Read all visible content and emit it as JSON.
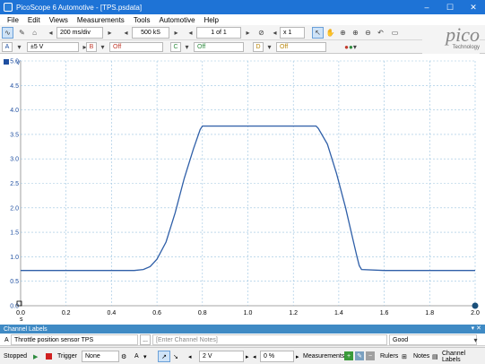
{
  "window": {
    "title": "PicoScope 6 Automotive - [TPS.psdata]",
    "minimize": "–",
    "maximize": "☐",
    "close": "✕"
  },
  "menu": [
    "File",
    "Edit",
    "Views",
    "Measurements",
    "Tools",
    "Automotive",
    "Help"
  ],
  "toolbar": {
    "timebase": "200 ms/div",
    "samples": "500 kS",
    "page_indicator": "1 of 1",
    "zoom": "x 1"
  },
  "channels": {
    "a_label": "A",
    "a_range": "±5 V",
    "b_label": "B",
    "b_value": "Off",
    "c_label": "C",
    "c_value": "Off",
    "d_label": "D",
    "d_value": "Off"
  },
  "logo": {
    "word": "pico",
    "sub": "Technology"
  },
  "axes": {
    "y_unit": "V",
    "y_ticks": [
      "5.0",
      "4.5",
      "4.0",
      "3.5",
      "3.0",
      "2.5",
      "2.0",
      "1.5",
      "1.0",
      "0.5",
      "0.0"
    ],
    "x_ticks": [
      "0.0",
      "0.2",
      "0.4",
      "0.6",
      "0.8",
      "1.0",
      "1.2",
      "1.4",
      "1.6",
      "1.8",
      "2.0"
    ],
    "x_unit": "s"
  },
  "chart_data": {
    "type": "line",
    "xlim": [
      0,
      2.0
    ],
    "ylim": [
      0,
      5.0
    ],
    "grid": true,
    "series": [
      {
        "color": "#2f5fa8",
        "x": [
          0.0,
          0.5,
          0.54,
          0.57,
          0.6,
          0.64,
          0.68,
          0.72,
          0.76,
          0.79,
          0.8,
          1.2,
          1.3,
          1.31,
          1.35,
          1.39,
          1.43,
          1.46,
          1.48,
          1.49,
          1.5,
          1.6,
          2.0
        ],
        "y": [
          0.72,
          0.72,
          0.74,
          0.8,
          0.95,
          1.3,
          1.9,
          2.6,
          3.2,
          3.6,
          3.67,
          3.67,
          3.67,
          3.62,
          3.3,
          2.7,
          2.0,
          1.4,
          1.0,
          0.82,
          0.74,
          0.72,
          0.72
        ]
      }
    ]
  },
  "channel_labels": {
    "header": "Channel Labels",
    "controls": "▾ ✕",
    "channel": "A",
    "name": "Throttle position sensor TPS",
    "browse": "...",
    "notes_placeholder": "[Enter Channel Notes]",
    "quality": "Good"
  },
  "status": {
    "state": "Stopped",
    "trigger_label": "Trigger",
    "trigger_mode": "None",
    "trigger_channel": "A",
    "threshold": "2 V",
    "pretrigger": "0 %",
    "measurements": "Measurements",
    "rulers": "Rulers",
    "notes": "Notes",
    "channel_labels": "Channel Labels"
  }
}
